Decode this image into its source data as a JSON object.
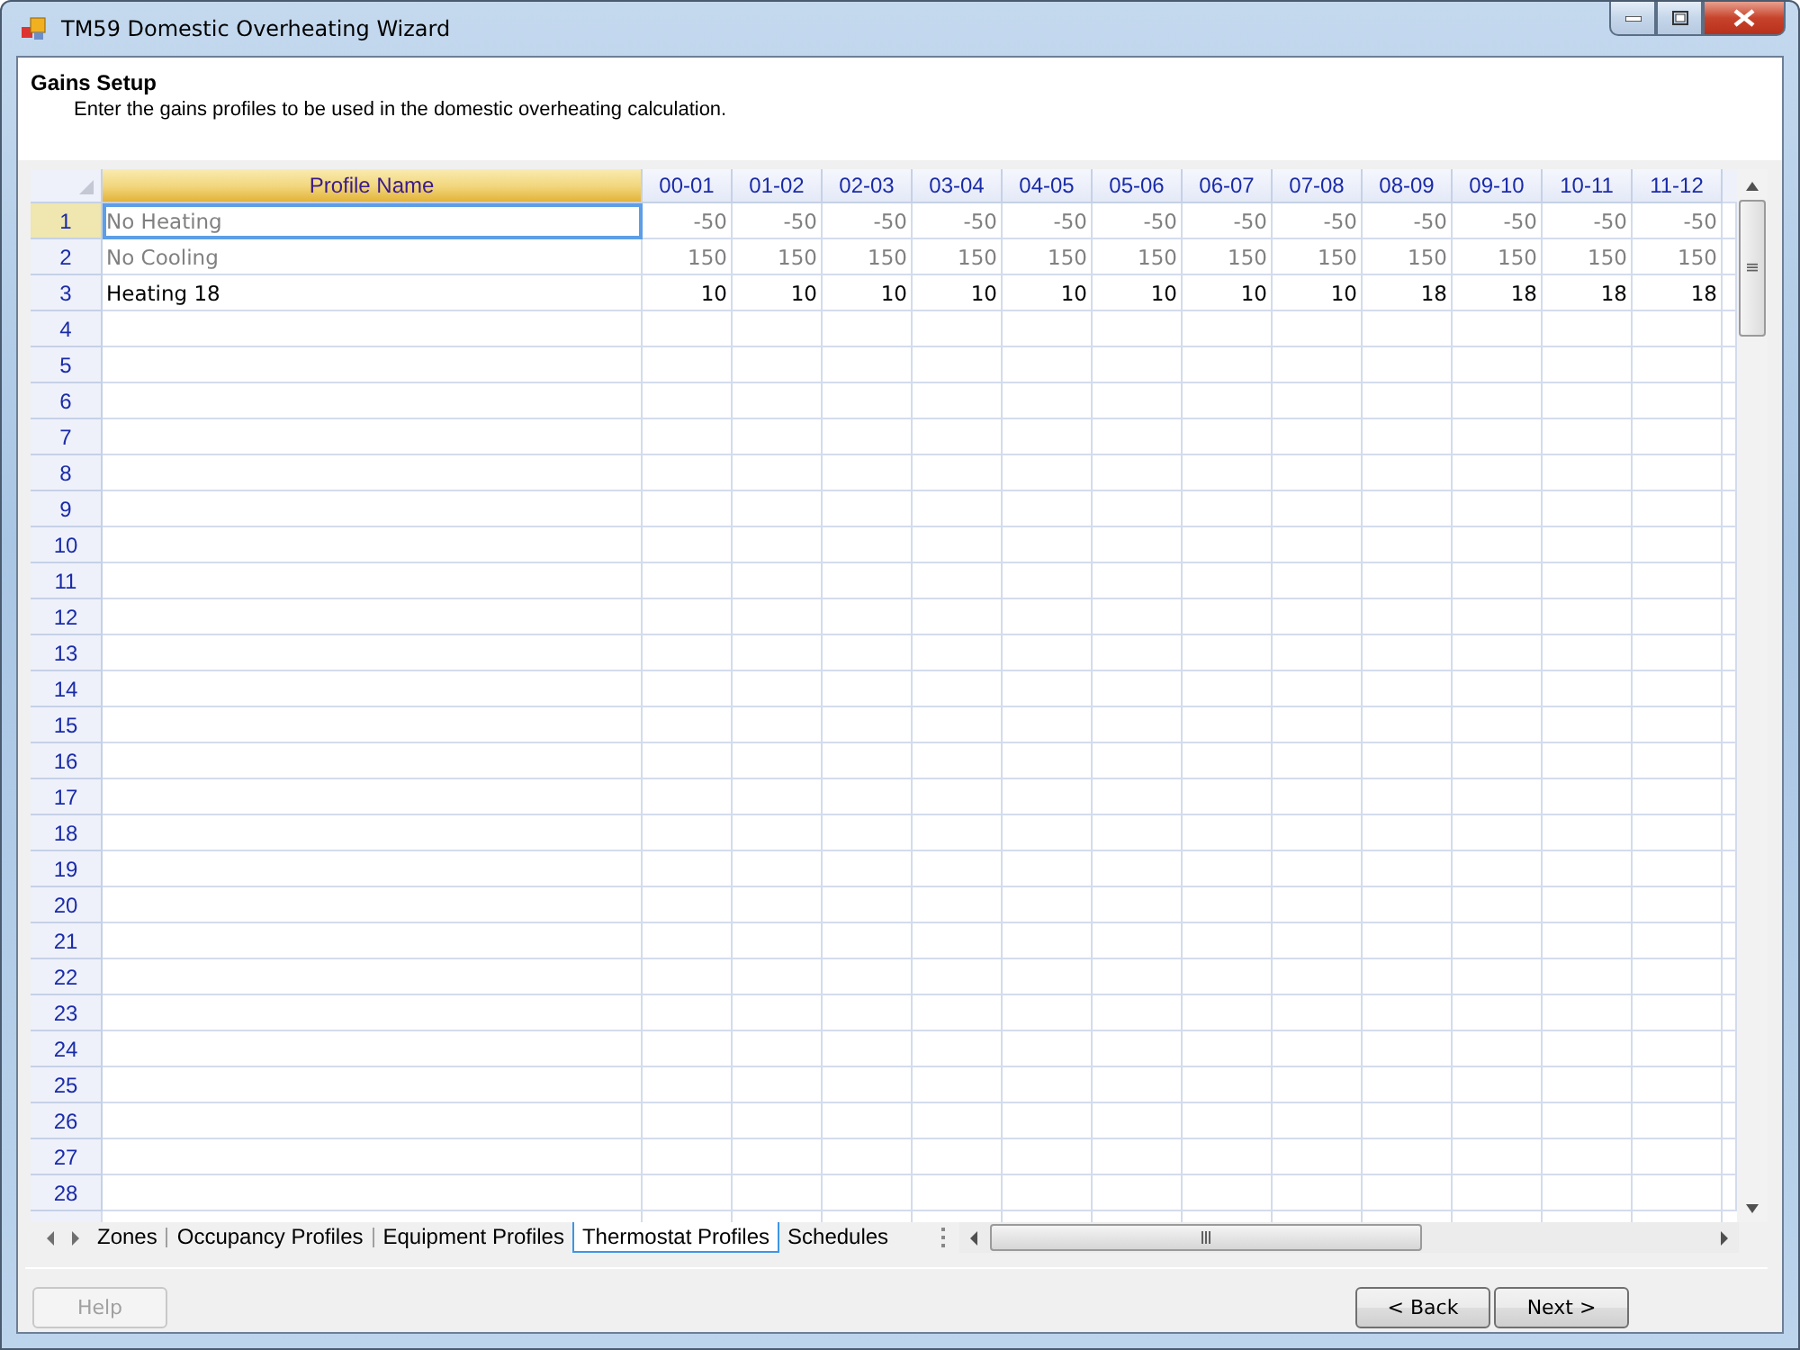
{
  "window": {
    "title": "TM59 Domestic Overheating Wizard"
  },
  "header": {
    "title": "Gains Setup",
    "subtitle": "Enter the gains profiles to be used in the domestic overheating calculation."
  },
  "table": {
    "columns": [
      {
        "label": "Profile Name",
        "selected": true
      },
      {
        "label": "00-01",
        "selected": false
      },
      {
        "label": "01-02",
        "selected": false
      },
      {
        "label": "02-03",
        "selected": false
      },
      {
        "label": "03-04",
        "selected": false
      },
      {
        "label": "04-05",
        "selected": false
      },
      {
        "label": "05-06",
        "selected": false
      },
      {
        "label": "06-07",
        "selected": false
      },
      {
        "label": "07-08",
        "selected": false
      },
      {
        "label": "08-09",
        "selected": false
      },
      {
        "label": "09-10",
        "selected": false
      },
      {
        "label": "10-11",
        "selected": false
      },
      {
        "label": "11-12",
        "selected": false
      }
    ],
    "rows": [
      {
        "number": "1",
        "selected": true,
        "readonly": true,
        "cells": [
          "No Heating",
          "-50",
          "-50",
          "-50",
          "-50",
          "-50",
          "-50",
          "-50",
          "-50",
          "-50",
          "-50",
          "-50",
          "-50"
        ]
      },
      {
        "number": "2",
        "selected": false,
        "readonly": true,
        "cells": [
          "No Cooling",
          "150",
          "150",
          "150",
          "150",
          "150",
          "150",
          "150",
          "150",
          "150",
          "150",
          "150",
          "150"
        ]
      },
      {
        "number": "3",
        "selected": false,
        "readonly": false,
        "cells": [
          "Heating 18",
          "10",
          "10",
          "10",
          "10",
          "10",
          "10",
          "10",
          "10",
          "18",
          "18",
          "18",
          "18"
        ]
      },
      {
        "number": "4",
        "selected": false
      },
      {
        "number": "5",
        "selected": false
      },
      {
        "number": "6",
        "selected": false
      },
      {
        "number": "7",
        "selected": false
      },
      {
        "number": "8",
        "selected": false
      },
      {
        "number": "9",
        "selected": false
      },
      {
        "number": "10",
        "selected": false
      },
      {
        "number": "11",
        "selected": false
      },
      {
        "number": "12",
        "selected": false
      },
      {
        "number": "13",
        "selected": false
      },
      {
        "number": "14",
        "selected": false
      },
      {
        "number": "15",
        "selected": false
      },
      {
        "number": "16",
        "selected": false
      },
      {
        "number": "17",
        "selected": false
      },
      {
        "number": "18",
        "selected": false
      },
      {
        "number": "19",
        "selected": false
      },
      {
        "number": "20",
        "selected": false
      },
      {
        "number": "21",
        "selected": false
      },
      {
        "number": "22",
        "selected": false
      },
      {
        "number": "23",
        "selected": false
      },
      {
        "number": "24",
        "selected": false
      },
      {
        "number": "25",
        "selected": false
      },
      {
        "number": "26",
        "selected": false
      },
      {
        "number": "27",
        "selected": false
      },
      {
        "number": "28",
        "selected": false
      }
    ]
  },
  "sheet_tabs": [
    {
      "label": "Zones",
      "selected": false
    },
    {
      "label": "Occupancy Profiles",
      "selected": false
    },
    {
      "label": "Equipment Profiles",
      "selected": false
    },
    {
      "label": "Thermostat Profiles",
      "selected": true
    },
    {
      "label": "Schedules",
      "selected": false
    }
  ],
  "buttons": [
    {
      "label": "Help",
      "disabled": true
    },
    {
      "label": "< Back",
      "disabled": false
    },
    {
      "label": "Next >",
      "disabled": false
    }
  ]
}
